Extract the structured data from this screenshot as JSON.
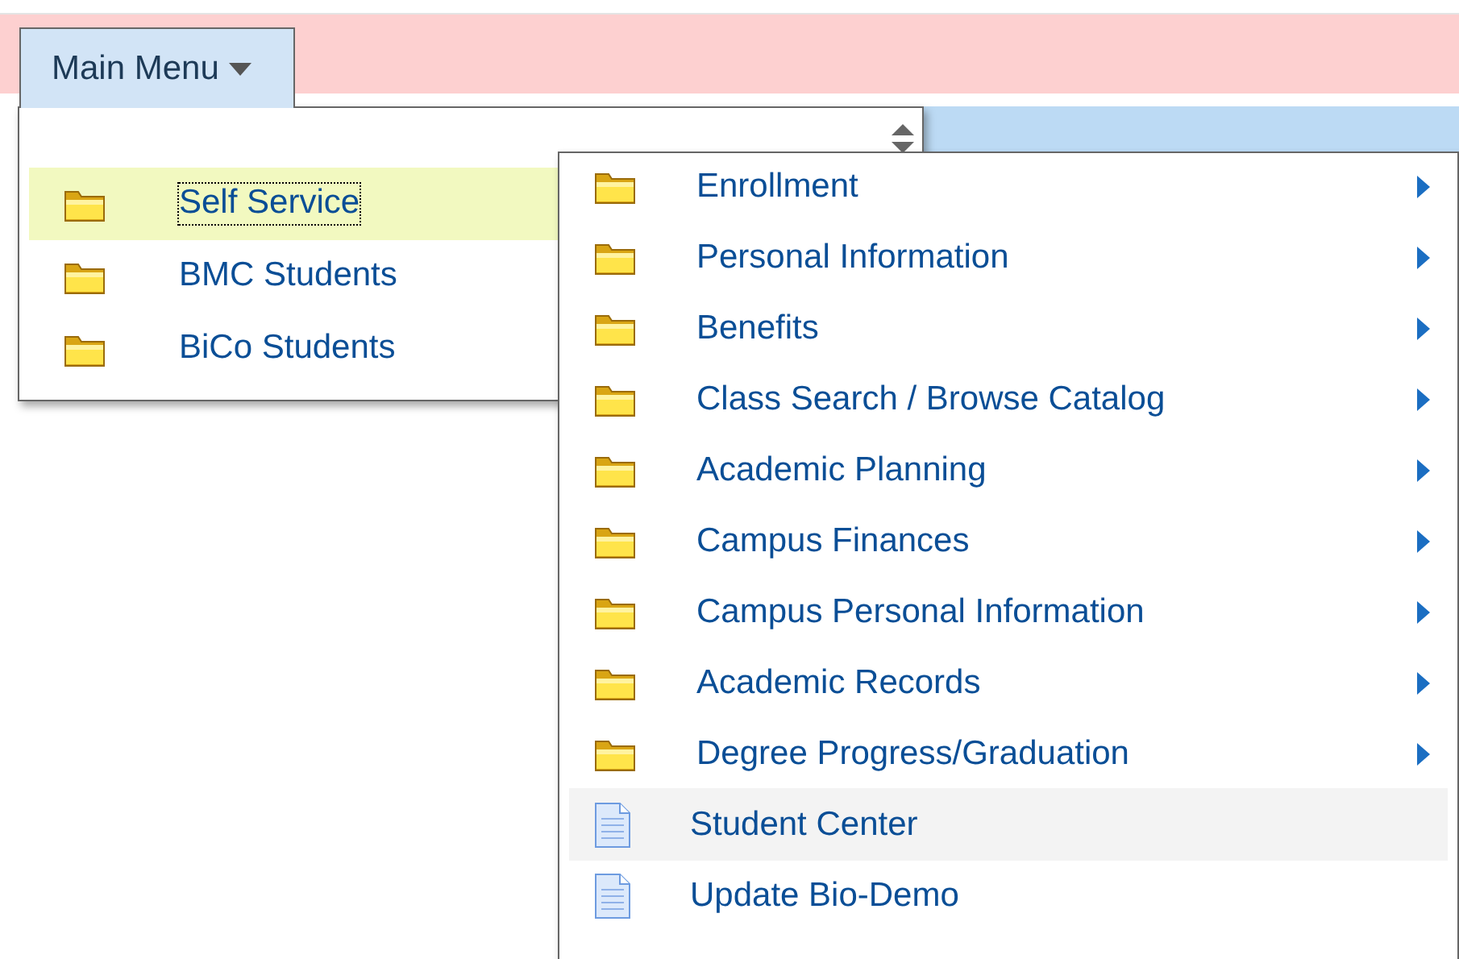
{
  "main_menu": {
    "label": "Main Menu"
  },
  "menu": {
    "items": [
      {
        "label": "Self Service",
        "kind": "folder",
        "selected": true
      },
      {
        "label": "BMC Students",
        "kind": "folder",
        "selected": false
      },
      {
        "label": "BiCo Students",
        "kind": "folder",
        "selected": false
      }
    ]
  },
  "submenu": {
    "items": [
      {
        "label": "Enrollment",
        "kind": "folder",
        "hovered": false
      },
      {
        "label": "Personal Information",
        "kind": "folder",
        "hovered": false
      },
      {
        "label": "Benefits",
        "kind": "folder",
        "hovered": false
      },
      {
        "label": "Class Search / Browse Catalog",
        "kind": "folder",
        "hovered": false
      },
      {
        "label": "Academic Planning",
        "kind": "folder",
        "hovered": false
      },
      {
        "label": "Campus Finances",
        "kind": "folder",
        "hovered": false
      },
      {
        "label": "Campus Personal Information",
        "kind": "folder",
        "hovered": false
      },
      {
        "label": "Academic Records",
        "kind": "folder",
        "hovered": false
      },
      {
        "label": "Degree Progress/Graduation",
        "kind": "folder",
        "hovered": false
      },
      {
        "label": "Student Center",
        "kind": "page",
        "hovered": true
      },
      {
        "label": "Update Bio-Demo",
        "kind": "page",
        "hovered": false
      }
    ]
  }
}
